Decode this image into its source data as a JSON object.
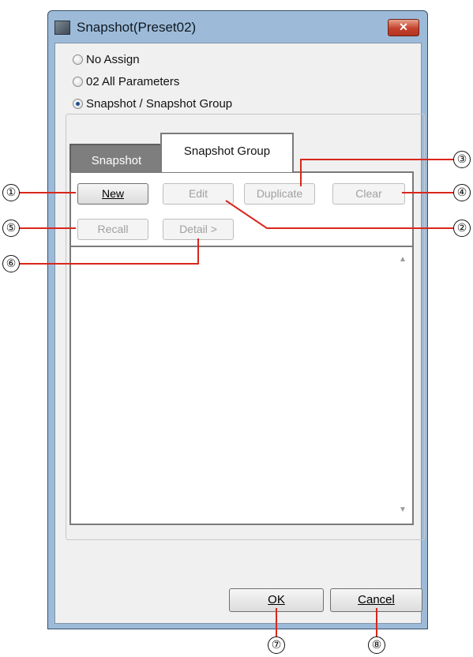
{
  "window": {
    "title": "Snapshot(Preset02)",
    "close_label": "✕"
  },
  "radios": [
    {
      "label": "No Assign",
      "checked": false
    },
    {
      "label": "02 All Parameters",
      "checked": false
    },
    {
      "label": "Snapshot / Snapshot Group",
      "checked": true
    }
  ],
  "tabs": {
    "snapshot": "Snapshot",
    "snapshot_group": "Snapshot Group",
    "active": "Snapshot Group"
  },
  "buttons": {
    "new": "New",
    "edit": "Edit",
    "duplicate": "Duplicate",
    "clear": "Clear",
    "recall": "Recall",
    "detail": "Detail >"
  },
  "footer": {
    "ok": "OK",
    "cancel": "Cancel"
  },
  "callouts": [
    "①",
    "②",
    "③",
    "④",
    "⑤",
    "⑥",
    "⑦",
    "⑧"
  ],
  "colors": {
    "callout_line": "#d9261c",
    "title_bar": "#9dbbd9",
    "close_button": "#c4412c"
  }
}
